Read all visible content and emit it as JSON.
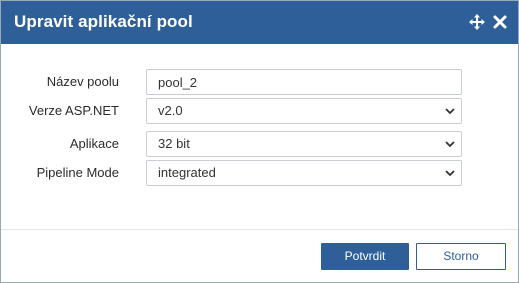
{
  "dialog": {
    "title": "Upravit aplikační pool",
    "icons": {
      "move": "move-icon",
      "close": "close-icon"
    }
  },
  "form": {
    "pool_name": {
      "label": "Název poolu",
      "value": "pool_2"
    },
    "aspnet_version": {
      "label": "Verze ASP.NET",
      "value": "v2.0"
    },
    "application": {
      "label": "Aplikace",
      "value": "32 bit"
    },
    "pipeline_mode": {
      "label": "Pipeline Mode",
      "value": "integrated"
    }
  },
  "buttons": {
    "confirm": "Potvrdit",
    "cancel": "Storno"
  },
  "colors": {
    "accent": "#2e5f98",
    "border": "#c8ced4"
  }
}
